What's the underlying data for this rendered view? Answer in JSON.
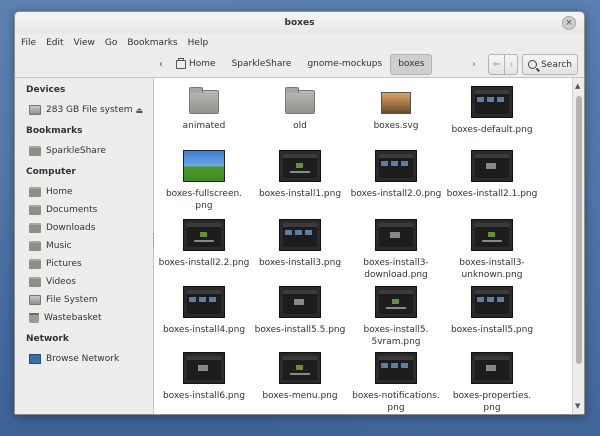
{
  "window": {
    "title": "boxes"
  },
  "menubar": {
    "items": [
      "File",
      "Edit",
      "View",
      "Go",
      "Bookmarks",
      "Help"
    ]
  },
  "toolbar": {
    "breadcrumbs": [
      "Home",
      "SparkleShare",
      "gnome-mockups",
      "boxes"
    ],
    "active_crumb": "boxes",
    "search_label": "Search"
  },
  "sidebar": {
    "devices_header": "Devices",
    "devices": [
      {
        "label": "283 GB File system",
        "icon": "drive-icon"
      }
    ],
    "bookmarks_header": "Bookmarks",
    "bookmarks": [
      {
        "label": "SparkleShare",
        "icon": "folder-icon"
      }
    ],
    "computer_header": "Computer",
    "computer": [
      {
        "label": "Home",
        "icon": "folder-icon"
      },
      {
        "label": "Documents",
        "icon": "folder-icon"
      },
      {
        "label": "Downloads",
        "icon": "folder-icon"
      },
      {
        "label": "Music",
        "icon": "folder-icon"
      },
      {
        "label": "Pictures",
        "icon": "folder-icon"
      },
      {
        "label": "Videos",
        "icon": "folder-icon"
      },
      {
        "label": "File System",
        "icon": "drive-icon"
      },
      {
        "label": "Wastebasket",
        "icon": "trash-icon"
      }
    ],
    "network_header": "Network",
    "network": [
      {
        "label": "Browse Network",
        "icon": "network-icon"
      }
    ]
  },
  "files": [
    {
      "name": "animated",
      "type": "folder"
    },
    {
      "name": "old",
      "type": "folder"
    },
    {
      "name": "boxes.svg",
      "type": "svg"
    },
    {
      "name": "boxes-default.png",
      "type": "dark"
    },
    {
      "name": "boxes-fullscreen.\npng",
      "type": "xp"
    },
    {
      "name": "boxes-install1.png",
      "type": "dark"
    },
    {
      "name": "boxes-install2.0.png",
      "type": "dark"
    },
    {
      "name": "boxes-install2.1.png",
      "type": "dark"
    },
    {
      "name": "boxes-install2.2.png",
      "type": "dark"
    },
    {
      "name": "boxes-install3.png",
      "type": "dark"
    },
    {
      "name": "boxes-install3-\ndownload.png",
      "type": "dark"
    },
    {
      "name": "boxes-install3-\nunknown.png",
      "type": "dark"
    },
    {
      "name": "boxes-install4.png",
      "type": "dark"
    },
    {
      "name": "boxes-install5.5.png",
      "type": "dark"
    },
    {
      "name": "boxes-install5.\n5vram.png",
      "type": "dark"
    },
    {
      "name": "boxes-install5.png",
      "type": "dark"
    },
    {
      "name": "boxes-install6.png",
      "type": "dark"
    },
    {
      "name": "boxes-menu.png",
      "type": "dark"
    },
    {
      "name": "boxes-notifications.\npng",
      "type": "dark"
    },
    {
      "name": "boxes-properties.\npng",
      "type": "dark"
    }
  ]
}
